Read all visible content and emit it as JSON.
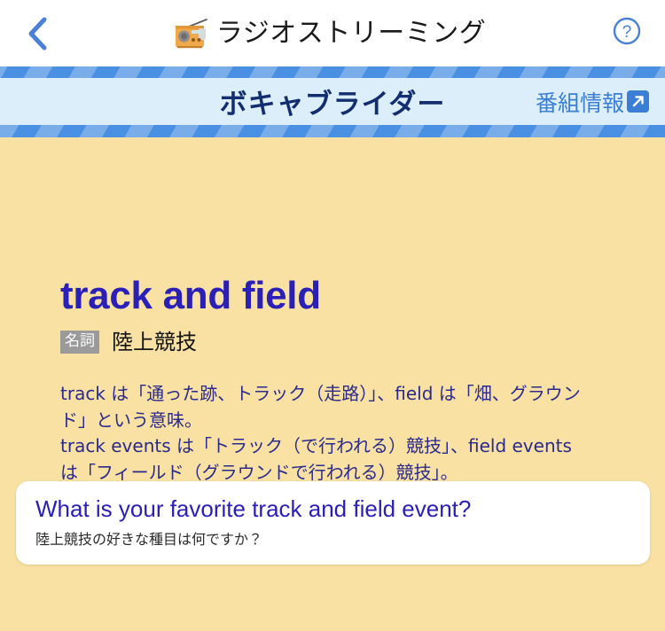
{
  "colors": {
    "background": "#f8e1a3",
    "accent_blue": "#4a90e2",
    "banner_band": "#ddeefb",
    "banner_title": "#132e6e",
    "headword": "#2a20b8",
    "explanation": "#2b2a8c",
    "badge_gray": "#9a9a9a",
    "card_white": "#ffffff"
  },
  "topbar": {
    "back_icon": "chevron-left-icon",
    "radio_icon": "radio-icon",
    "title": "ラジオストリーミング",
    "help_icon": "question-circle-icon"
  },
  "banner": {
    "program_title": "ボキャブライダー",
    "program_info_label": "番組情報",
    "program_info_icon": "external-link-icon"
  },
  "entry": {
    "headword": "track and field",
    "part_of_speech": "名詞",
    "meaning": "陸上競技",
    "explanation_lines": [
      "track は「通った跡、トラック（走路）」、field は「畑、グラウンド」という意味。",
      "track events は「トラック（で行われる）競技」、field events は「フィールド（グラウンドで行われる）競技」。"
    ]
  },
  "question_card": {
    "question_en": "What is your favorite track and field event?",
    "question_ja": "陸上競技の好きな種目は何ですか？"
  }
}
